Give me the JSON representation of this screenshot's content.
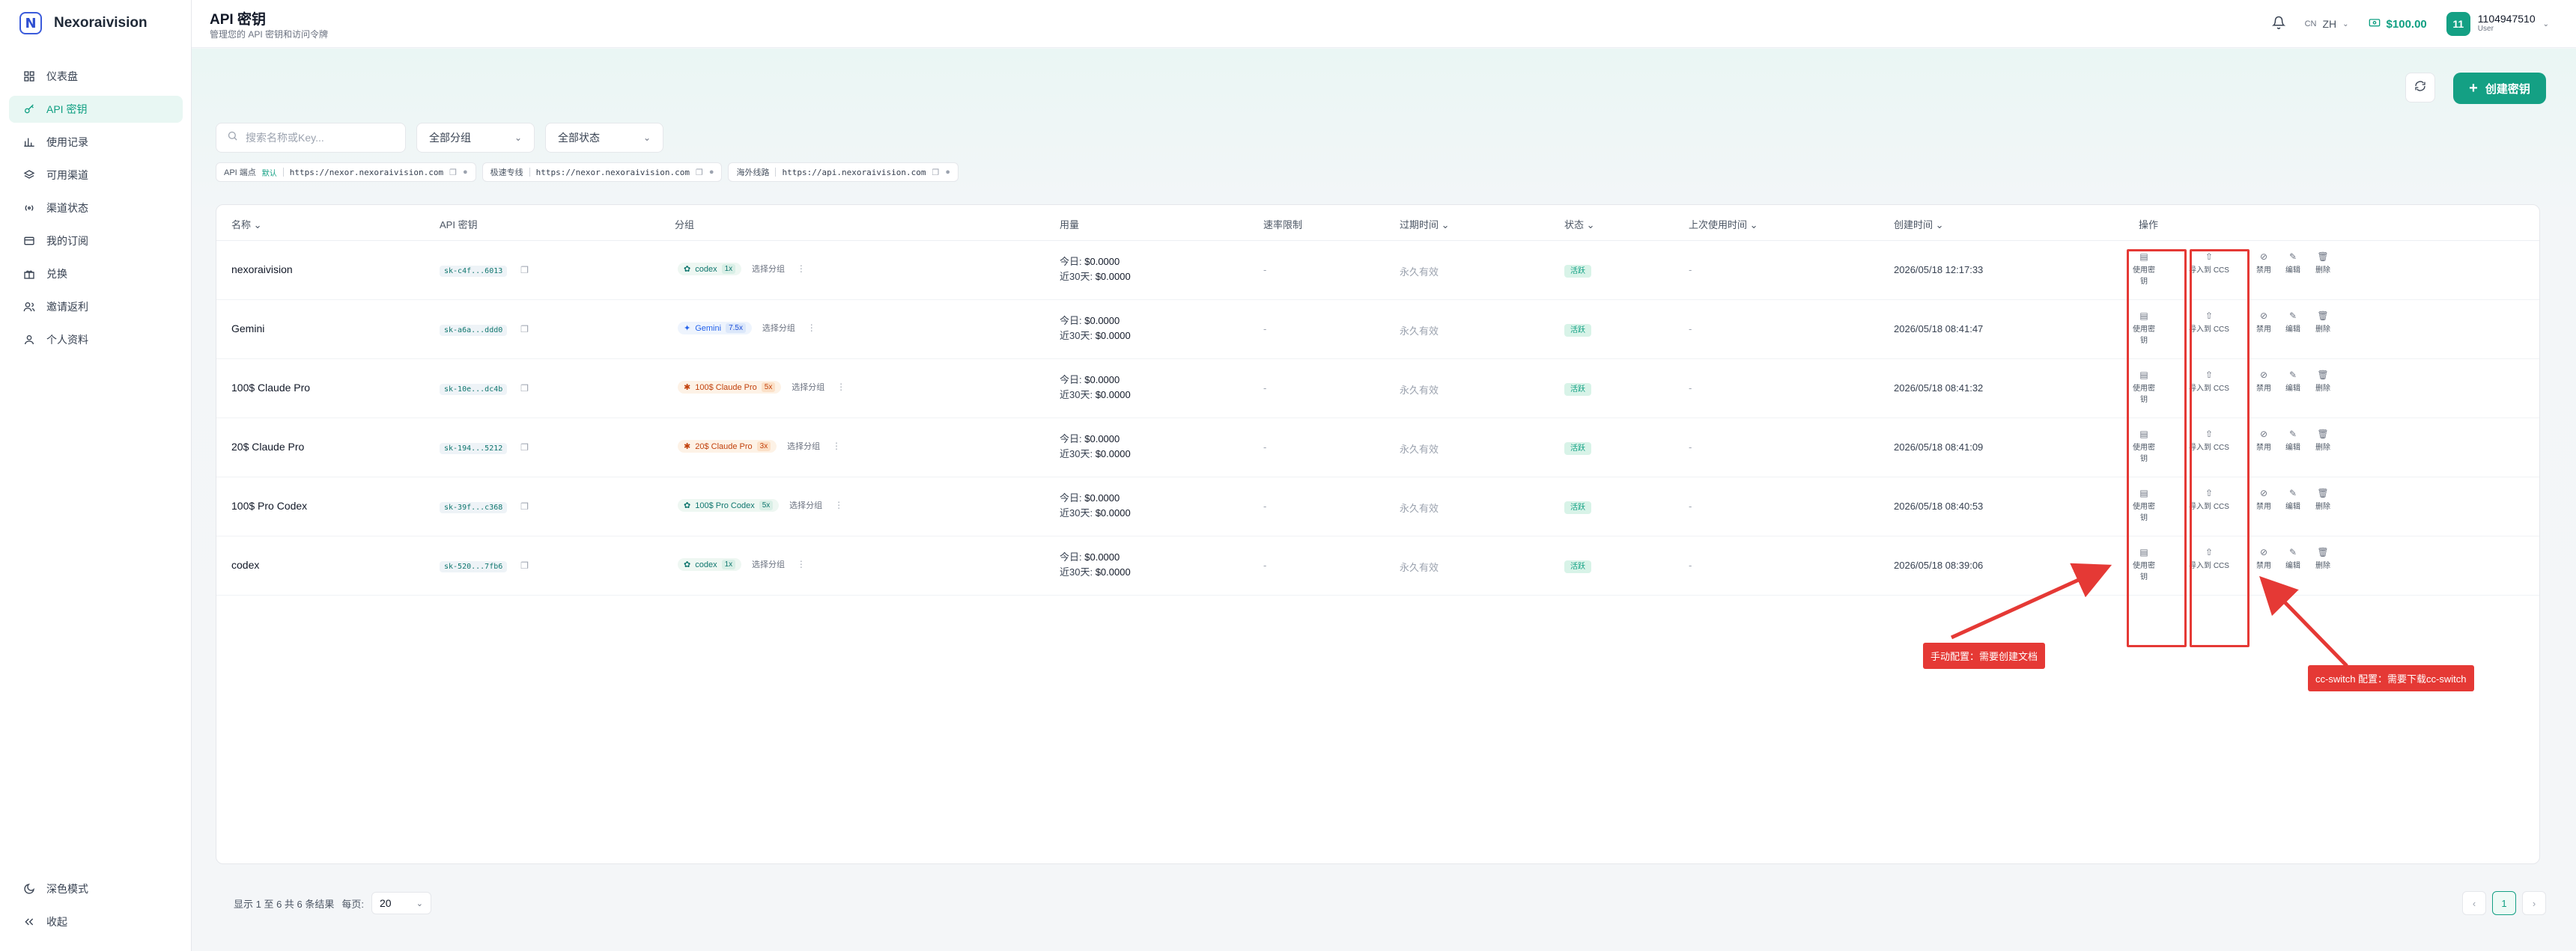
{
  "brand": {
    "logo_letter": "N",
    "name": "Nexoraivision"
  },
  "sidebar": {
    "items": [
      {
        "label": "仪表盘",
        "icon": "grid-icon"
      },
      {
        "label": "API 密钥",
        "icon": "key-icon",
        "active": true
      },
      {
        "label": "使用记录",
        "icon": "bar-chart-icon"
      },
      {
        "label": "可用渠道",
        "icon": "layers-icon"
      },
      {
        "label": "渠道状态",
        "icon": "broadcast-icon"
      },
      {
        "label": "我的订阅",
        "icon": "card-icon"
      },
      {
        "label": "兑换",
        "icon": "gift-icon"
      },
      {
        "label": "邀请返利",
        "icon": "users-icon"
      },
      {
        "label": "个人资料",
        "icon": "user-icon"
      }
    ],
    "bottom": [
      {
        "label": "深色模式",
        "icon": "moon-icon"
      },
      {
        "label": "收起",
        "icon": "collapse-icon"
      }
    ]
  },
  "header": {
    "title": "API 密钥",
    "subtitle": "管理您的 API 密钥和访问令牌",
    "lang_code": "CN",
    "lang": "ZH",
    "balance": "$100.00",
    "user": {
      "avatar": "11",
      "name": "1104947510",
      "role": "User"
    }
  },
  "toolbar": {
    "create_label": "创建密钥",
    "search_placeholder": "搜索名称或Key...",
    "group_filter": "全部分组",
    "status_filter": "全部状态"
  },
  "endpoints": [
    {
      "label": "API 端点",
      "tag": "默认",
      "url": "https://nexor.nexoraivision.com"
    },
    {
      "label": "极速专线",
      "tag": "",
      "url": "https://nexor.nexoraivision.com"
    },
    {
      "label": "海外线路",
      "tag": "",
      "url": "https://api.nexoraivision.com"
    }
  ],
  "table": {
    "columns": {
      "name": "名称",
      "key": "API 密钥",
      "group": "分组",
      "usage": "用量",
      "rate": "速率限制",
      "expiry": "过期时间",
      "status": "状态",
      "last_used": "上次使用时间",
      "created": "创建时间",
      "actions": "操作"
    },
    "labels": {
      "today": "今日:",
      "last30": "近30天:",
      "select_group": "选择分组",
      "use_key": "使用密钥",
      "import_ccs": "导入到 CCS",
      "disable": "禁用",
      "edit": "编辑",
      "delete": "删除"
    },
    "rows": [
      {
        "name": "nexoraivision",
        "key": "sk-c4f...6013",
        "group": "codex",
        "mult": "1x",
        "group_icon": "openai",
        "today": "$0.0000",
        "last30": "$0.0000",
        "rate": "-",
        "expiry": "永久有效",
        "status": "活跃",
        "last_used": "-",
        "created": "2026/05/18 12:17:33"
      },
      {
        "name": "Gemini",
        "key": "sk-a6a...ddd0",
        "group": "Gemini",
        "mult": "7.5x",
        "group_icon": "gemini",
        "today": "$0.0000",
        "last30": "$0.0000",
        "rate": "-",
        "expiry": "永久有效",
        "status": "活跃",
        "last_used": "-",
        "created": "2026/05/18 08:41:47"
      },
      {
        "name": "100$ Claude Pro",
        "key": "sk-10e...dc4b",
        "group": "100$ Claude Pro",
        "mult": "5x",
        "group_icon": "claude",
        "today": "$0.0000",
        "last30": "$0.0000",
        "rate": "-",
        "expiry": "永久有效",
        "status": "活跃",
        "last_used": "-",
        "created": "2026/05/18 08:41:32"
      },
      {
        "name": "20$ Claude Pro",
        "key": "sk-194...5212",
        "group": "20$ Claude Pro",
        "mult": "3x",
        "group_icon": "claude",
        "today": "$0.0000",
        "last30": "$0.0000",
        "rate": "-",
        "expiry": "永久有效",
        "status": "活跃",
        "last_used": "-",
        "created": "2026/05/18 08:41:09"
      },
      {
        "name": "100$ Pro Codex",
        "key": "sk-39f...c368",
        "group": "100$ Pro Codex",
        "mult": "5x",
        "group_icon": "openai",
        "today": "$0.0000",
        "last30": "$0.0000",
        "rate": "-",
        "expiry": "永久有效",
        "status": "活跃",
        "last_used": "-",
        "created": "2026/05/18 08:40:53"
      },
      {
        "name": "codex",
        "key": "sk-520...7fb6",
        "group": "codex",
        "mult": "1x",
        "group_icon": "openai",
        "today": "$0.0000",
        "last30": "$0.0000",
        "rate": "-",
        "expiry": "永久有效",
        "status": "活跃",
        "last_used": "-",
        "created": "2026/05/18 08:39:06"
      }
    ]
  },
  "annotations": {
    "manual": "手动配置：需要创建文档",
    "ccswitch": "cc-switch 配置：需要下载cc-switch"
  },
  "footer": {
    "summary": "显示 1 至 6 共 6 条结果",
    "per_page_label": "每页:",
    "per_page": "20",
    "current_page": "1"
  },
  "colors": {
    "accent": "#14a084",
    "annotation": "#e53935"
  }
}
